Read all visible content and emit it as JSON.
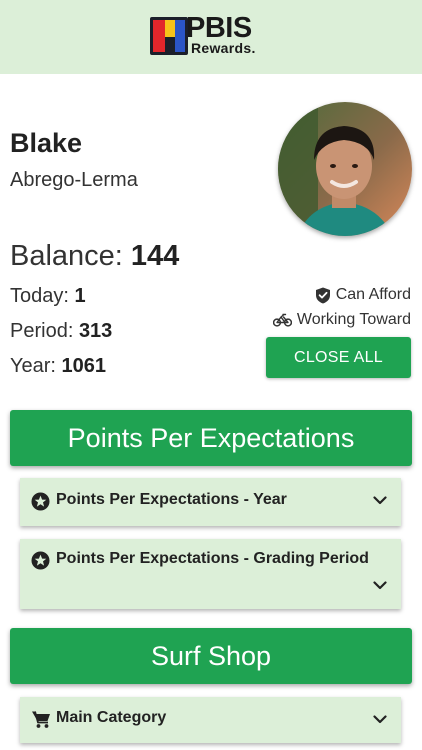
{
  "header": {
    "logo_text": "PBIS",
    "logo_subtext": "Rewards."
  },
  "student": {
    "first_name": "Blake",
    "last_name": "Abrego-Lerma"
  },
  "points": {
    "balance_label": "Balance:",
    "balance_value": "144",
    "today_label": "Today:",
    "today_value": "1",
    "period_label": "Period:",
    "period_value": "313",
    "year_label": "Year:",
    "year_value": "1061"
  },
  "legend": {
    "can_afford": "Can Afford",
    "working_toward": "Working Toward"
  },
  "close_all_label": "CLOSE ALL",
  "sections": {
    "expectations": {
      "title": "Points Per Expectations",
      "items": [
        {
          "label": "Points Per Expectations - Year",
          "icon": "star-circle-icon"
        },
        {
          "label": "Points Per Expectations - Grading Period",
          "icon": "star-circle-icon"
        }
      ]
    },
    "shop": {
      "title": "Surf Shop",
      "items": [
        {
          "label": "Main Category",
          "icon": "cart-icon"
        }
      ]
    }
  },
  "colors": {
    "accent_green": "#1fa352",
    "light_green": "#dcefd8"
  }
}
